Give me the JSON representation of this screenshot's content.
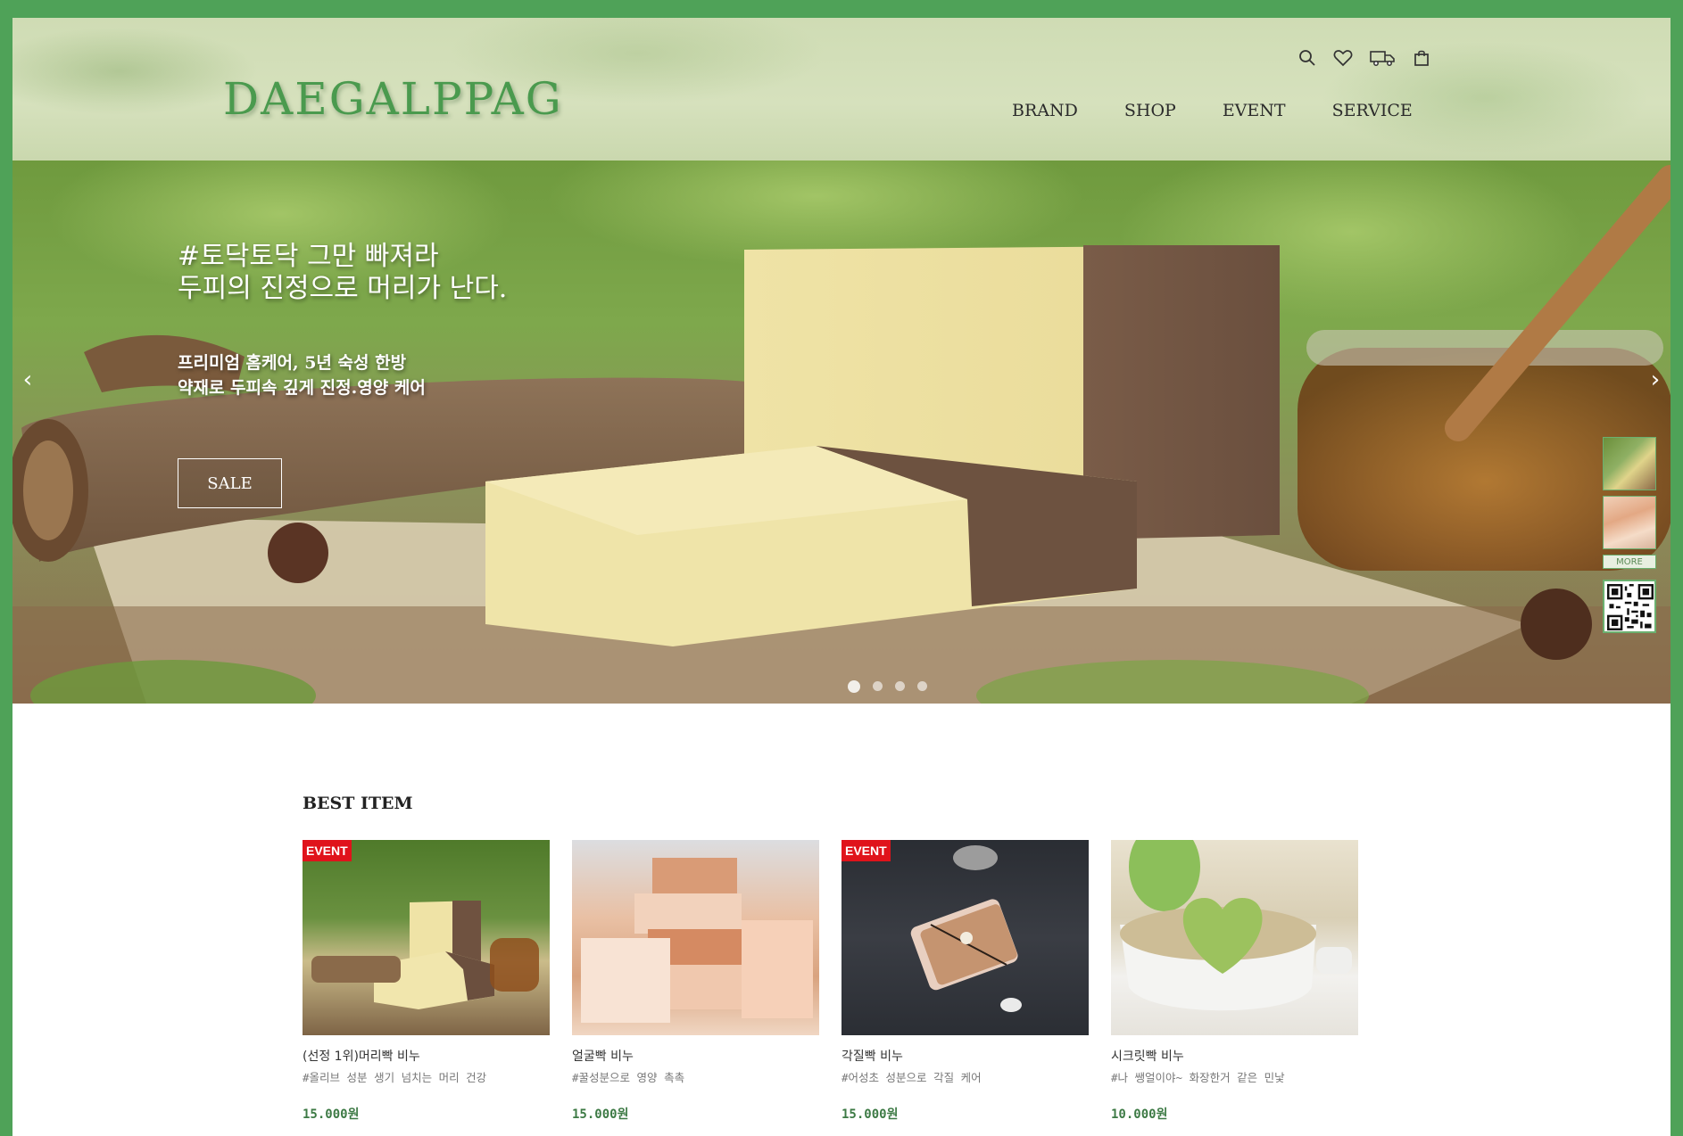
{
  "brand": {
    "logo": "DAEGALPPAG"
  },
  "utility_icons": [
    "search-icon",
    "heart-icon",
    "truck-icon",
    "bag-icon"
  ],
  "nav": {
    "brand": "BRAND",
    "shop": "SHOP",
    "event": "EVENT",
    "service": "SERVICE"
  },
  "hero": {
    "title": "#토닥토닥 그만 빠져라\n두피의 진정으로 머리가 난다.",
    "subtitle": "프리미엄 홈케어, 5년 숙성 한방\n약재로 두피속 깊게 진정.영양 케어",
    "button": "SALE",
    "prev": "‹",
    "next": "›",
    "slides_total": 4,
    "active_slide": 1
  },
  "quick": {
    "more": "MORE"
  },
  "best": {
    "title": "BEST ITEM",
    "items": [
      {
        "badge": "EVENT",
        "name": "(선정 1위)머리빡 비누",
        "desc": "#올리브 성분 생기 넘치는 머리 건강",
        "price": "15.000원"
      },
      {
        "badge": "",
        "name": "얼굴빡 비누",
        "desc": "#꿀성분으로 영양 촉촉",
        "price": "15.000원"
      },
      {
        "badge": "EVENT",
        "name": "각질빡 비누",
        "desc": "#어성초 성분으로 각질 케어",
        "price": "15.000원"
      },
      {
        "badge": "",
        "name": "시크릿빡 비누",
        "desc": "#나 쌩얼이야~ 화장한거 같은 민낯",
        "price": "10.000원"
      }
    ]
  },
  "colors": {
    "frame_green": "#4fa258",
    "logo_green": "#4a9a4e",
    "price_green": "#3d7a45",
    "badge_red": "#e0131b"
  }
}
